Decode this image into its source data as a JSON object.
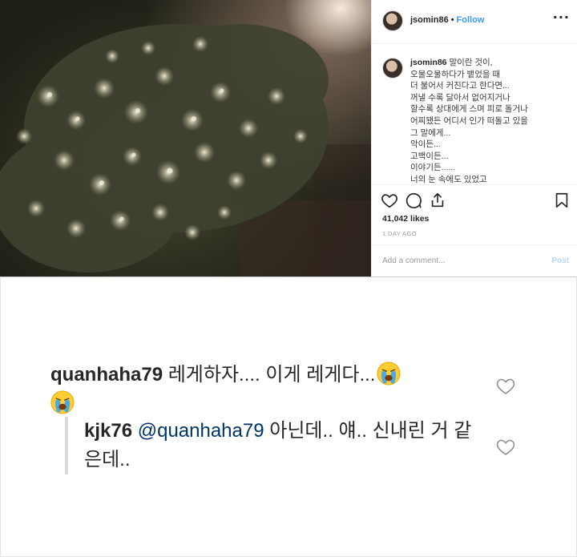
{
  "post": {
    "username": "jsomin86",
    "dot": "•",
    "follow_label": "Follow",
    "more_label": "···",
    "caption_user": "jsomin86",
    "caption_text": "말이란 것이,\n오물오물하다가 뱉었을 때\n더 불어서 커진다고 한다면...\n꺼낼 수록 닳아서 없어지거나\n할수록 상대에게 스며 피로 돌거나\n어찌됐든 어디서 인가 떠돌고 있을\n그 말에게...\n악이든...\n고백이든...\n이야기든......\n너의 눈 속에도 있었고",
    "likes": "41,042 likes",
    "time_ago": "1 DAY AGO",
    "comment_placeholder": "Add a comment...",
    "post_label": "Post",
    "icons": [
      "heart-icon",
      "comment-icon",
      "share-icon",
      "bookmark-icon"
    ]
  },
  "comments": [
    {
      "username": "quanhaha79",
      "text": " 레게하자.... 이게 레게다...",
      "emoji": [
        "crying-face-emoji",
        "crying-face-emoji"
      ]
    },
    {
      "username": "kjk76",
      "mention": "@quanhaha79",
      "text": " 아닌데.. 얘.. 신내린 거 같은데.."
    }
  ],
  "colors": {
    "link": "#3897f0",
    "mention": "#003569",
    "text": "#262626",
    "muted": "#999999"
  }
}
